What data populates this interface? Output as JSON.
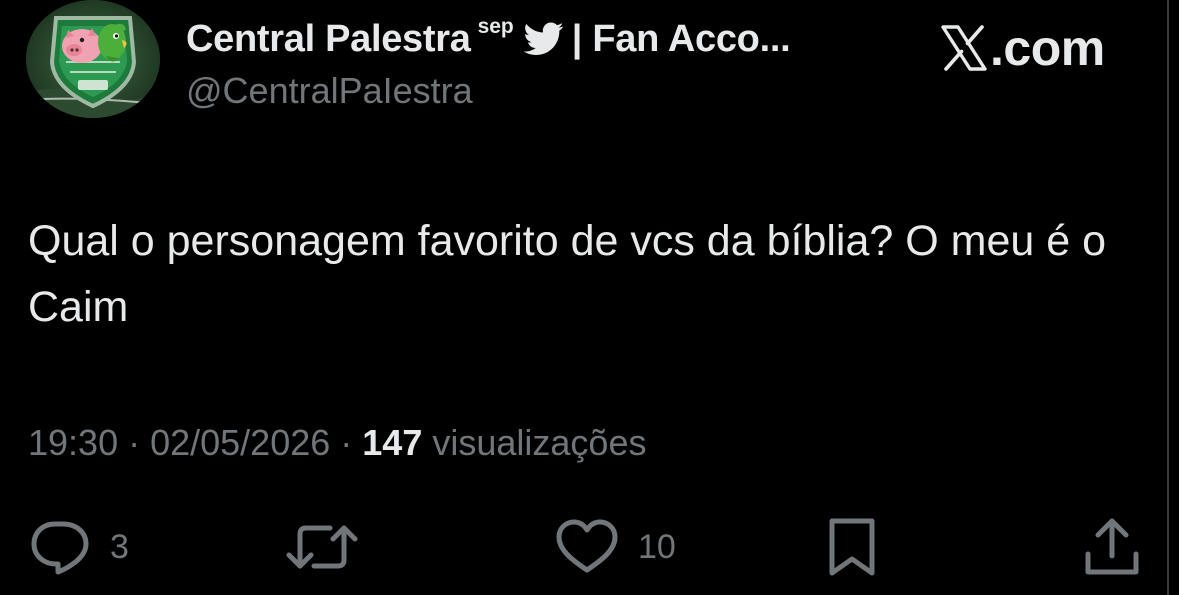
{
  "header": {
    "display_name": "Central Palestra",
    "name_superscript": "sep",
    "name_suffix": "| Fan Acco...",
    "handle": "@CentralPaIestra",
    "brand_domain": ".com"
  },
  "tweet": {
    "text": "Qual o personagem favorito de vcs da bíblia? O meu é o Caim"
  },
  "meta": {
    "time": "19:30",
    "separator": "·",
    "date": "02/05/2026",
    "views_count": "147",
    "views_label": "visualizações"
  },
  "actions": {
    "reply_count": "3",
    "retweet_count": "",
    "like_count": "10"
  },
  "icons": {
    "verified_bird": "twitter-bird-icon",
    "brand": "x-logo-icon",
    "reply": "reply-icon",
    "retweet": "retweet-icon",
    "like": "heart-icon",
    "bookmark": "bookmark-icon",
    "share": "share-icon"
  },
  "colors": {
    "background": "#000000",
    "text_primary": "#e7e9ea",
    "text_secondary": "#71767b"
  }
}
